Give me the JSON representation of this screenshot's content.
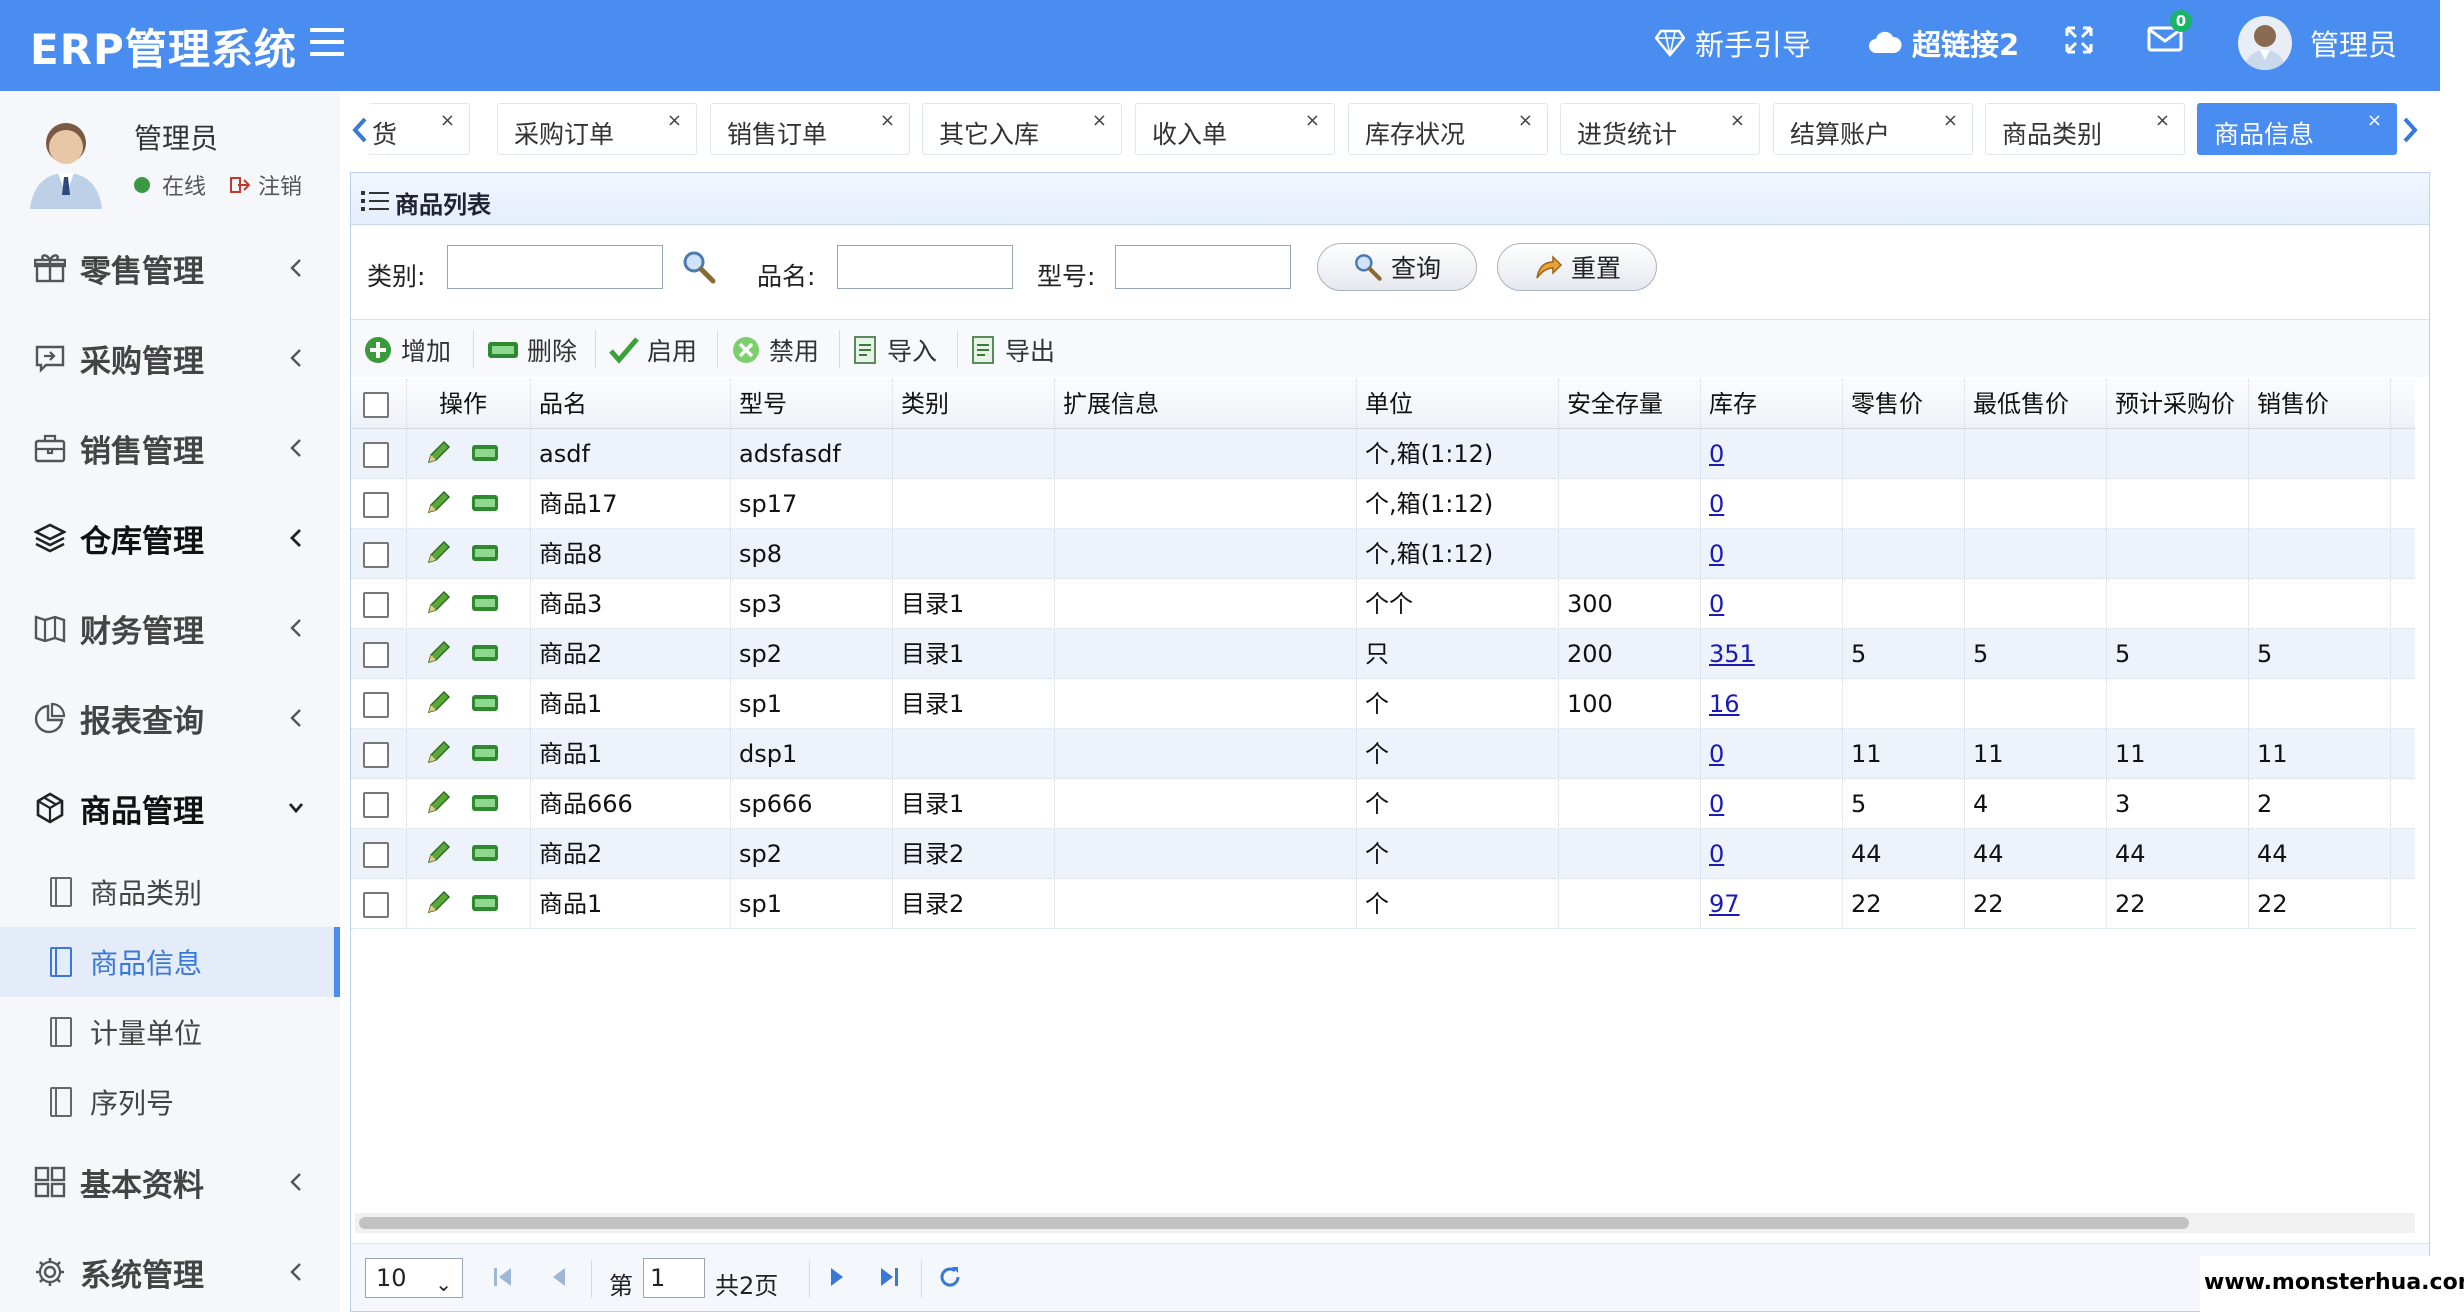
{
  "header": {
    "brand": "ERP管理系统",
    "guide": "新手引导",
    "hyperlink": "超链接2",
    "mail_count": "0",
    "user": "管理员"
  },
  "sidebar": {
    "profile_name": "管理员",
    "online": "在线",
    "logout": "注销",
    "menu": [
      {
        "label": "零售管理",
        "icon": "gift-icon"
      },
      {
        "label": "采购管理",
        "icon": "purchase-icon"
      },
      {
        "label": "销售管理",
        "icon": "briefcase-icon"
      },
      {
        "label": "仓库管理",
        "icon": "layers-icon"
      },
      {
        "label": "财务管理",
        "icon": "book-icon"
      },
      {
        "label": "报表查询",
        "icon": "chart-icon"
      },
      {
        "label": "商品管理",
        "icon": "cube-icon"
      },
      {
        "label": "基本资料",
        "icon": "grid-icon"
      },
      {
        "label": "系统管理",
        "icon": "gear-icon"
      }
    ],
    "submenu": [
      "商品类别",
      "商品信息",
      "计量单位",
      "序列号"
    ]
  },
  "tabs": [
    {
      "label": "货"
    },
    {
      "label": "采购订单"
    },
    {
      "label": "销售订单"
    },
    {
      "label": "其它入库"
    },
    {
      "label": "收入单"
    },
    {
      "label": "库存状况"
    },
    {
      "label": "进货统计"
    },
    {
      "label": "结算账户"
    },
    {
      "label": "商品类别"
    },
    {
      "label": "商品信息"
    }
  ],
  "panel": {
    "title": "商品列表",
    "search": {
      "category_label": "类别:",
      "name_label": "品名:",
      "model_label": "型号:",
      "query_button": "查询",
      "reset_button": "重置"
    },
    "toolbar": {
      "add": "增加",
      "delete": "删除",
      "enable": "启用",
      "disable": "禁用",
      "import": "导入",
      "export": "导出"
    },
    "columns": [
      "操作",
      "品名",
      "型号",
      "类别",
      "扩展信息",
      "单位",
      "安全存量",
      "库存",
      "零售价",
      "最低售价",
      "预计采购价",
      "销售价"
    ],
    "rows": [
      {
        "name": "asdf",
        "model": "adsfasdf",
        "category": "",
        "ext": "",
        "unit": "个,箱(1:12)",
        "safety": "",
        "stock": "0",
        "retail": "",
        "min": "",
        "purchase": "",
        "sale": ""
      },
      {
        "name": "商品17",
        "model": "sp17",
        "category": "",
        "ext": "",
        "unit": "个,箱(1:12)",
        "safety": "",
        "stock": "0",
        "retail": "",
        "min": "",
        "purchase": "",
        "sale": ""
      },
      {
        "name": "商品8",
        "model": "sp8",
        "category": "",
        "ext": "",
        "unit": "个,箱(1:12)",
        "safety": "",
        "stock": "0",
        "retail": "",
        "min": "",
        "purchase": "",
        "sale": ""
      },
      {
        "name": "商品3",
        "model": "sp3",
        "category": "目录1",
        "ext": "",
        "unit": "个个",
        "safety": "300",
        "stock": "0",
        "retail": "",
        "min": "",
        "purchase": "",
        "sale": ""
      },
      {
        "name": "商品2",
        "model": "sp2",
        "category": "目录1",
        "ext": "",
        "unit": "只",
        "safety": "200",
        "stock": "351",
        "retail": "5",
        "min": "5",
        "purchase": "5",
        "sale": "5"
      },
      {
        "name": "商品1",
        "model": "sp1",
        "category": "目录1",
        "ext": "",
        "unit": "个",
        "safety": "100",
        "stock": "16",
        "retail": "",
        "min": "",
        "purchase": "",
        "sale": ""
      },
      {
        "name": "商品1",
        "model": "dsp1",
        "category": "",
        "ext": "",
        "unit": "个",
        "safety": "",
        "stock": "0",
        "retail": "11",
        "min": "11",
        "purchase": "11",
        "sale": "11"
      },
      {
        "name": "商品666",
        "model": "sp666",
        "category": "目录1",
        "ext": "",
        "unit": "个",
        "safety": "",
        "stock": "0",
        "retail": "5",
        "min": "4",
        "purchase": "3",
        "sale": "2"
      },
      {
        "name": "商品2",
        "model": "sp2",
        "category": "目录2",
        "ext": "",
        "unit": "个",
        "safety": "",
        "stock": "0",
        "retail": "44",
        "min": "44",
        "purchase": "44",
        "sale": "44"
      },
      {
        "name": "商品1",
        "model": "sp1",
        "category": "目录2",
        "ext": "",
        "unit": "个",
        "safety": "",
        "stock": "97",
        "retail": "22",
        "min": "22",
        "purchase": "22",
        "sale": "22"
      }
    ],
    "pager": {
      "page_size": "10",
      "page_prefix": "第",
      "page_value": "1",
      "page_total": "共2页"
    }
  },
  "watermark": "www.monsterhua.com",
  "colors": {
    "header": "#4a8df0",
    "active_tab": "#4a8df0",
    "link": "#1a1ab8"
  }
}
